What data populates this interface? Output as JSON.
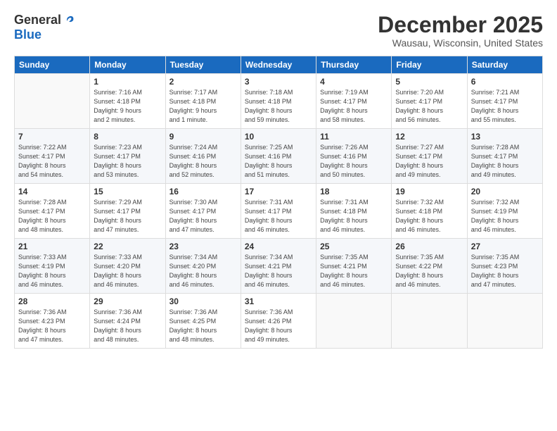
{
  "logo": {
    "general": "General",
    "blue": "Blue"
  },
  "title": "December 2025",
  "location": "Wausau, Wisconsin, United States",
  "days_of_week": [
    "Sunday",
    "Monday",
    "Tuesday",
    "Wednesday",
    "Thursday",
    "Friday",
    "Saturday"
  ],
  "weeks": [
    [
      {
        "day": "",
        "info": ""
      },
      {
        "day": "1",
        "info": "Sunrise: 7:16 AM\nSunset: 4:18 PM\nDaylight: 9 hours\nand 2 minutes."
      },
      {
        "day": "2",
        "info": "Sunrise: 7:17 AM\nSunset: 4:18 PM\nDaylight: 9 hours\nand 1 minute."
      },
      {
        "day": "3",
        "info": "Sunrise: 7:18 AM\nSunset: 4:18 PM\nDaylight: 8 hours\nand 59 minutes."
      },
      {
        "day": "4",
        "info": "Sunrise: 7:19 AM\nSunset: 4:17 PM\nDaylight: 8 hours\nand 58 minutes."
      },
      {
        "day": "5",
        "info": "Sunrise: 7:20 AM\nSunset: 4:17 PM\nDaylight: 8 hours\nand 56 minutes."
      },
      {
        "day": "6",
        "info": "Sunrise: 7:21 AM\nSunset: 4:17 PM\nDaylight: 8 hours\nand 55 minutes."
      }
    ],
    [
      {
        "day": "7",
        "info": "Sunrise: 7:22 AM\nSunset: 4:17 PM\nDaylight: 8 hours\nand 54 minutes."
      },
      {
        "day": "8",
        "info": "Sunrise: 7:23 AM\nSunset: 4:17 PM\nDaylight: 8 hours\nand 53 minutes."
      },
      {
        "day": "9",
        "info": "Sunrise: 7:24 AM\nSunset: 4:16 PM\nDaylight: 8 hours\nand 52 minutes."
      },
      {
        "day": "10",
        "info": "Sunrise: 7:25 AM\nSunset: 4:16 PM\nDaylight: 8 hours\nand 51 minutes."
      },
      {
        "day": "11",
        "info": "Sunrise: 7:26 AM\nSunset: 4:16 PM\nDaylight: 8 hours\nand 50 minutes."
      },
      {
        "day": "12",
        "info": "Sunrise: 7:27 AM\nSunset: 4:17 PM\nDaylight: 8 hours\nand 49 minutes."
      },
      {
        "day": "13",
        "info": "Sunrise: 7:28 AM\nSunset: 4:17 PM\nDaylight: 8 hours\nand 49 minutes."
      }
    ],
    [
      {
        "day": "14",
        "info": "Sunrise: 7:28 AM\nSunset: 4:17 PM\nDaylight: 8 hours\nand 48 minutes."
      },
      {
        "day": "15",
        "info": "Sunrise: 7:29 AM\nSunset: 4:17 PM\nDaylight: 8 hours\nand 47 minutes."
      },
      {
        "day": "16",
        "info": "Sunrise: 7:30 AM\nSunset: 4:17 PM\nDaylight: 8 hours\nand 47 minutes."
      },
      {
        "day": "17",
        "info": "Sunrise: 7:31 AM\nSunset: 4:17 PM\nDaylight: 8 hours\nand 46 minutes."
      },
      {
        "day": "18",
        "info": "Sunrise: 7:31 AM\nSunset: 4:18 PM\nDaylight: 8 hours\nand 46 minutes."
      },
      {
        "day": "19",
        "info": "Sunrise: 7:32 AM\nSunset: 4:18 PM\nDaylight: 8 hours\nand 46 minutes."
      },
      {
        "day": "20",
        "info": "Sunrise: 7:32 AM\nSunset: 4:19 PM\nDaylight: 8 hours\nand 46 minutes."
      }
    ],
    [
      {
        "day": "21",
        "info": "Sunrise: 7:33 AM\nSunset: 4:19 PM\nDaylight: 8 hours\nand 46 minutes."
      },
      {
        "day": "22",
        "info": "Sunrise: 7:33 AM\nSunset: 4:20 PM\nDaylight: 8 hours\nand 46 minutes."
      },
      {
        "day": "23",
        "info": "Sunrise: 7:34 AM\nSunset: 4:20 PM\nDaylight: 8 hours\nand 46 minutes."
      },
      {
        "day": "24",
        "info": "Sunrise: 7:34 AM\nSunset: 4:21 PM\nDaylight: 8 hours\nand 46 minutes."
      },
      {
        "day": "25",
        "info": "Sunrise: 7:35 AM\nSunset: 4:21 PM\nDaylight: 8 hours\nand 46 minutes."
      },
      {
        "day": "26",
        "info": "Sunrise: 7:35 AM\nSunset: 4:22 PM\nDaylight: 8 hours\nand 46 minutes."
      },
      {
        "day": "27",
        "info": "Sunrise: 7:35 AM\nSunset: 4:23 PM\nDaylight: 8 hours\nand 47 minutes."
      }
    ],
    [
      {
        "day": "28",
        "info": "Sunrise: 7:36 AM\nSunset: 4:23 PM\nDaylight: 8 hours\nand 47 minutes."
      },
      {
        "day": "29",
        "info": "Sunrise: 7:36 AM\nSunset: 4:24 PM\nDaylight: 8 hours\nand 48 minutes."
      },
      {
        "day": "30",
        "info": "Sunrise: 7:36 AM\nSunset: 4:25 PM\nDaylight: 8 hours\nand 48 minutes."
      },
      {
        "day": "31",
        "info": "Sunrise: 7:36 AM\nSunset: 4:26 PM\nDaylight: 8 hours\nand 49 minutes."
      },
      {
        "day": "",
        "info": ""
      },
      {
        "day": "",
        "info": ""
      },
      {
        "day": "",
        "info": ""
      }
    ]
  ]
}
